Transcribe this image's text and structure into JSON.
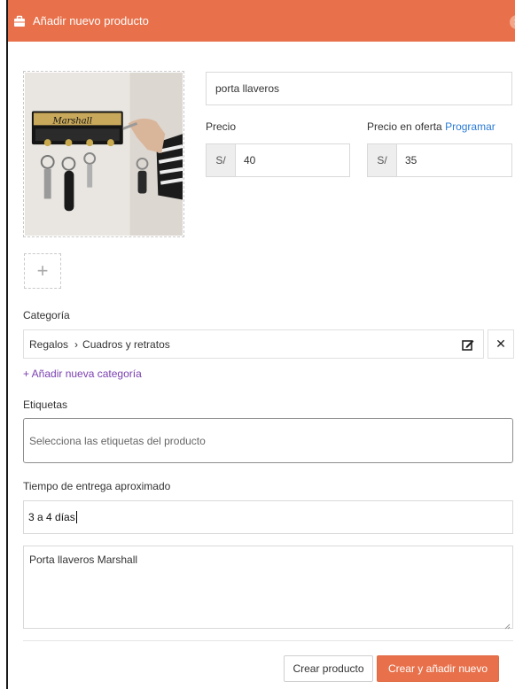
{
  "dialog": {
    "title": "Añadir nuevo producto",
    "close_icon": "close-icon",
    "header_color": "#e8704a"
  },
  "product": {
    "image_description_icon": "product-image",
    "add_image_symbol": "+",
    "name_value": "porta llaveros"
  },
  "pricing": {
    "price_label": "Precio",
    "offer_label": "Precio en oferta",
    "schedule_link": "Programar",
    "currency": "S/",
    "price_value": "40",
    "offer_value": "35"
  },
  "category": {
    "label": "Categoría",
    "parent": "Regalos",
    "separator": "›",
    "child": "Cuadros y retratos",
    "remove_symbol": "✕",
    "add_link": "+ Añadir nueva categoría"
  },
  "tags": {
    "label": "Etiquetas",
    "placeholder": "Selecciona las etiquetas del producto"
  },
  "delivery": {
    "label": "Tiempo de entrega aproximado",
    "value": "3 a 4 días"
  },
  "description": {
    "value": "Porta llaveros Marshall"
  },
  "actions": {
    "create_label": "Crear producto",
    "create_add_label": "Crear y añadir nuevo",
    "primary_color": "#e8704a"
  }
}
